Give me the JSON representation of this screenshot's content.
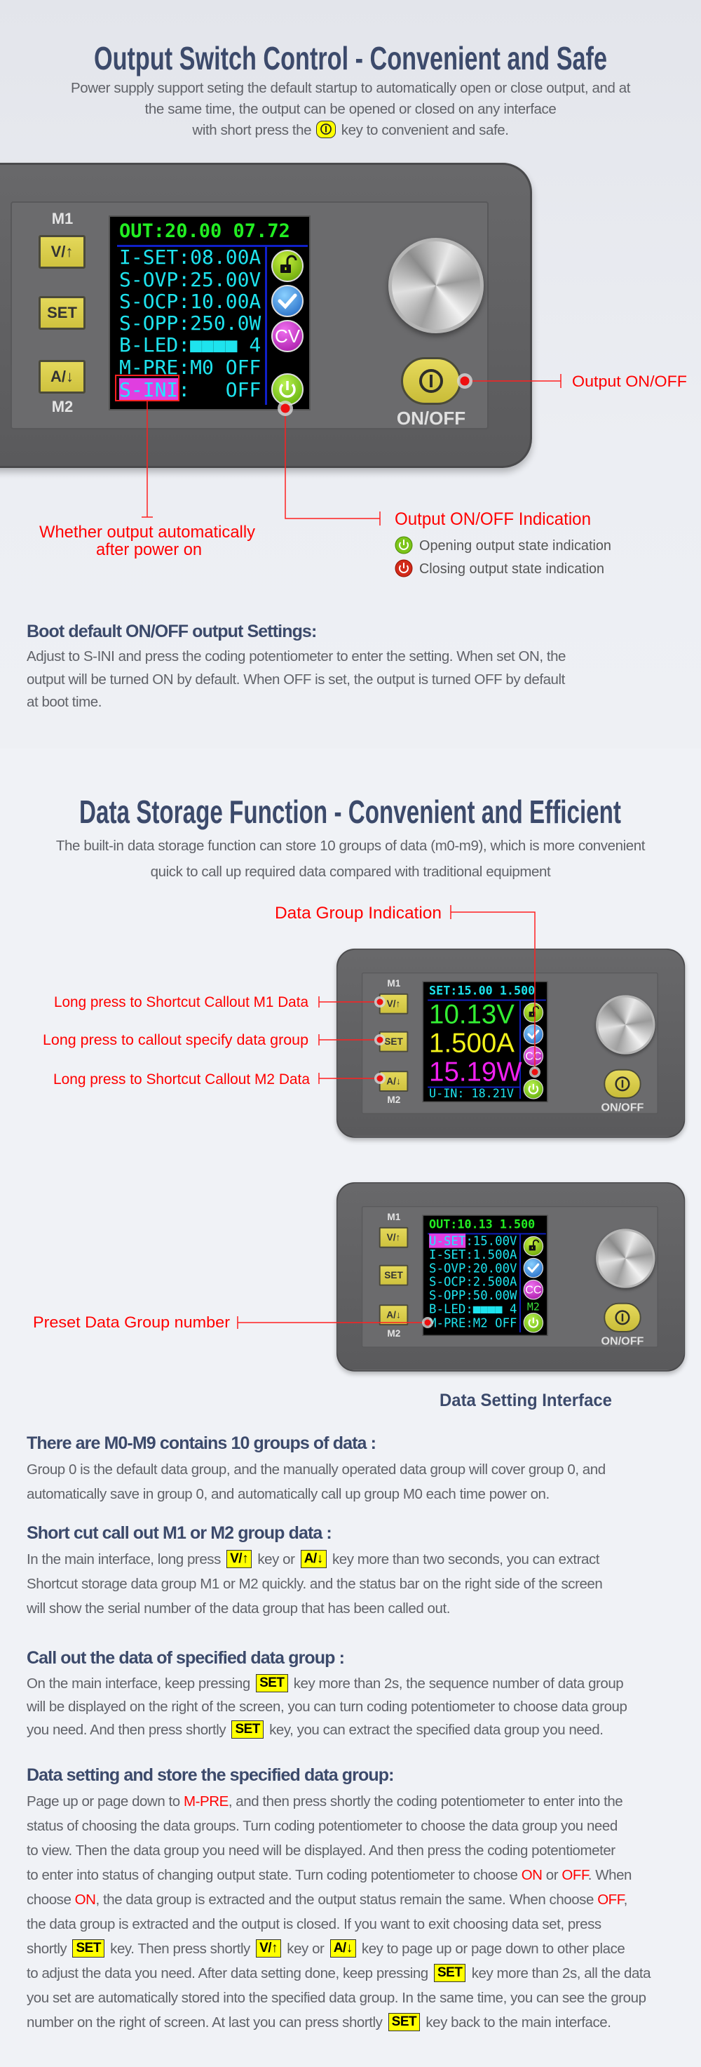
{
  "section1": {
    "title": "Output Switch Control - Convenient and Safe",
    "subtitle_lines": [
      "Power supply support seting the default startup to automatically open or close output, and at",
      "the same time, the output can be opened or closed on any interface"
    ],
    "subtitle_last_before": "with short press the",
    "subtitle_last_after": "key to convenient and safe.",
    "labels": {
      "output_onoff": "Output ON/OFF",
      "auto_output_1": "Whether output automatically",
      "auto_output_2": "after power on",
      "indication": "Output ON/OFF Indication",
      "opening": "Opening output state indication",
      "closing": "Closing output state indication"
    }
  },
  "section2": {
    "title": "Data Storage Function - Convenient and Efficient",
    "subtitle_lines": [
      "The built-in data storage function can store 10 groups of data (m0-m9), which is more convenient",
      "quick to call up required data compared with traditional equipment"
    ],
    "labels": {
      "data_group_indication": "Data Group Indication",
      "m1_callout": "Long press to Shortcut Callout M1 Data",
      "specify_group": "Long press to callout specify data group",
      "m2_callout": "Long press to Shortcut Callout M2 Data",
      "preset_number": "Preset Data Group number",
      "setting_interface": "Data Setting Interface"
    }
  },
  "device_labels": {
    "m1": "M1",
    "m2": "M2",
    "up": "V/↑",
    "set": "SET",
    "down": "A/↓",
    "onoff": "ON/OFF"
  },
  "colors": {
    "title": "#3c4a6b",
    "callout": "#ff0000",
    "key": "#ffff00",
    "screen_green": "#22ee22",
    "screen_cyan": "#1ee3ee",
    "highlight": "#e03ee0"
  },
  "devices": [
    {
      "header": "OUT:20.00 07.72",
      "header_color": "#22ee22",
      "rows": [
        {
          "text": "I-SET:08.00A"
        },
        {
          "text": "S-OVP:25.00V"
        },
        {
          "text": "S-OCP:10.00A"
        },
        {
          "text": "S-OPP:250.0W"
        },
        {
          "text": "B-LED:■■■■ 4"
        },
        {
          "text": "M-PRE:M0 OFF"
        },
        {
          "hl": "S-INI",
          "text": ":   OFF"
        }
      ],
      "icons": [
        {
          "type": "lock-open"
        },
        {
          "type": "check"
        },
        {
          "type": "mode",
          "text": "CV"
        },
        {
          "type": "power"
        }
      ]
    },
    {
      "header": "SET:15.00 1.500",
      "header_color": "#1ee3ee",
      "big": [
        {
          "text": "10.13V",
          "color": "#33ee33"
        },
        {
          "text": "1.500A",
          "color": "#f2f21a"
        },
        {
          "text": "15.19W",
          "color": "#f020f0"
        }
      ],
      "footer": "U-IN: 18.21V",
      "icons": [
        {
          "type": "lock-open"
        },
        {
          "type": "check"
        },
        {
          "type": "mode",
          "text": "CC"
        },
        {
          "type": "power"
        }
      ]
    },
    {
      "header": "OUT:10.13 1.500",
      "header_color": "#22ee22",
      "rows": [
        {
          "hl": "U-SET",
          "text": ":15.00V"
        },
        {
          "text": "I-SET:1.500A"
        },
        {
          "text": "S-OVP:20.00V"
        },
        {
          "text": "S-OCP:2.500A"
        },
        {
          "text": "S-OPP:50.00W"
        },
        {
          "text": "B-LED:■■■■ 4"
        },
        {
          "text": "M-PRE:M2 OFF"
        }
      ],
      "icons": [
        {
          "type": "lock-open"
        },
        {
          "type": "check"
        },
        {
          "type": "mode",
          "text": "CC"
        },
        {
          "type": "group",
          "text": "M2"
        },
        {
          "type": "power"
        }
      ]
    }
  ],
  "text_blocks": [
    {
      "heading": "Boot default ON/OFF output Settings:",
      "lines": [
        [
          "Adjust to S-INI and press the coding potentiometer to enter the setting. When set ON, the"
        ],
        [
          "output will be turned ON by default. When OFF is set, the output is turned OFF by default"
        ],
        [
          "at boot time."
        ]
      ]
    },
    {
      "heading": "There are M0-M9 contains 10 groups of data :",
      "lines": [
        [
          "Group 0 is the default data group, and the manually operated data group will cover group 0, and"
        ],
        [
          "automatically save in group 0, and automatically call up group M0 each time power on."
        ]
      ]
    },
    {
      "heading": "Short cut call out M1 or M2 group data :",
      "lines": [
        [
          "In the main interface, long press ",
          {
            "key": "V/↑"
          },
          " key or ",
          {
            "key": "A/↓"
          },
          " key more than two seconds, you can extract"
        ],
        [
          "Shortcut storage data group M1 or M2 quickly. and the status bar on the right side of the screen"
        ],
        [
          "will show the serial number of the data group that has been called out."
        ]
      ]
    },
    {
      "heading": "Call out the data of specified data group :",
      "lines": [
        [
          "On the main interface, keep pressing ",
          {
            "key": "SET"
          },
          " key more than 2s, the sequence number of data group"
        ],
        [
          "will be displayed on the right of the screen, you can turn coding potentiometer to choose data group"
        ],
        [
          "you need. And then press shortly ",
          {
            "key": "SET"
          },
          " key, you can extract the specified data group you need."
        ]
      ]
    },
    {
      "heading": "Data setting and store the specified data group:",
      "lines": [
        [
          "Page up or page down to ",
          {
            "red": "M-PRE"
          },
          ", and then press shortly the coding potentiometer to enter into the"
        ],
        [
          "status of choosing the data groups. Turn coding potentiometer to choose the data group you need"
        ],
        [
          "to view. Then the data group you need will be displayed. And then press the coding potentiometer"
        ],
        [
          "to enter into status of changing output state. Turn coding potentiometer to choose ",
          {
            "red": "ON"
          },
          " or ",
          {
            "red": "OFF"
          },
          ". When"
        ],
        [
          "choose ",
          {
            "red": "ON"
          },
          ", the data group is extracted and the output status remain the same. When choose ",
          {
            "red": "OFF"
          },
          ","
        ],
        [
          "the data group is extracted and the output is closed. If you want to exit choosing data set, press"
        ],
        [
          "shortly ",
          {
            "key": "SET"
          },
          " key. Then press shortly ",
          {
            "key": "V/↑"
          },
          " key or ",
          {
            "key": "A/↓"
          },
          " key to page up or page down to other place"
        ],
        [
          "to adjust the data you need. After data setting done, keep pressing ",
          {
            "key": "SET"
          },
          " key more than 2s, all the data"
        ],
        [
          "you set are automatically stored into the specified data group. In the same time, you can see the group"
        ],
        [
          "number on the right of screen. At last you can press shortly ",
          {
            "key": "SET"
          },
          " key back to the main interface."
        ]
      ]
    }
  ]
}
